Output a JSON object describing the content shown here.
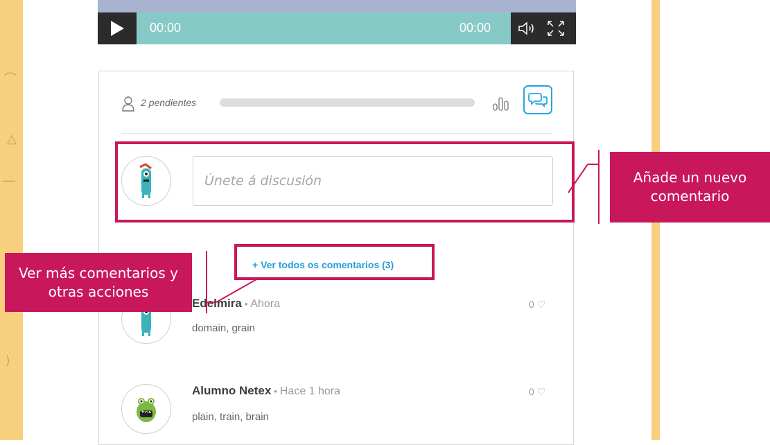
{
  "player": {
    "current_time": "00:00",
    "duration": "00:00",
    "icons": {
      "play": "play-icon",
      "volume": "volume-icon",
      "fullscreen": "fullscreen-icon"
    },
    "colors": {
      "bar": "#86c9c6",
      "controls": "#2b2b2b"
    }
  },
  "discussion": {
    "pending_label": "2 pendientes",
    "progress_fraction": 0.0,
    "input_placeholder": "Únete á discusión",
    "view_all_label": "+ Ver todos os comentarios (3)",
    "comments": [
      {
        "author": "Edelmira",
        "separator": "•",
        "time": "Ahora",
        "text": "domain, grain",
        "likes": "0"
      },
      {
        "author": "Alumno Netex",
        "separator": "•",
        "time": "Hace 1 hora",
        "text": "plain, train, brain",
        "likes": "0"
      }
    ],
    "colors": {
      "accent": "#25a6de",
      "link": "#1f9fd8"
    }
  },
  "annotations": {
    "new_comment_callout": "Añade un nuevo comentario",
    "more_comments_callout": "Ver más comentarios y otras acciones",
    "color": "#c9175b"
  }
}
